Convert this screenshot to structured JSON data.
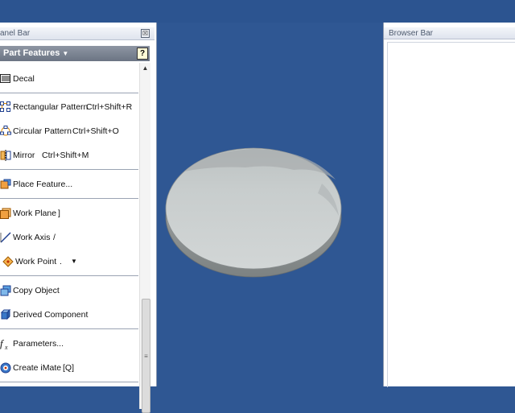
{
  "panel_bar": {
    "title": "anel Bar",
    "close_glyph": "☒",
    "section_label": "Part Features",
    "section_caret": "▼",
    "help_glyph": "?",
    "items": [
      {
        "label": "Decal",
        "shortcut": "",
        "icon": "decal-icon"
      },
      {
        "label": "Rectangular Pattern",
        "shortcut": "Ctrl+Shift+R",
        "icon": "rectangular-pattern-icon"
      },
      {
        "label": "Circular Pattern",
        "shortcut": "Ctrl+Shift+O",
        "icon": "circular-pattern-icon"
      },
      {
        "label": "Mirror",
        "shortcut": "Ctrl+Shift+M",
        "icon": "mirror-icon"
      },
      {
        "label": "Place Feature...",
        "shortcut": "",
        "icon": "place-feature-icon"
      },
      {
        "label": "Work Plane",
        "shortcut": "]",
        "icon": "work-plane-icon"
      },
      {
        "label": "Work Axis",
        "shortcut": "/",
        "icon": "work-axis-icon"
      },
      {
        "label": "Work Point",
        "shortcut": ".",
        "icon": "work-point-icon"
      },
      {
        "label": "Copy Object",
        "shortcut": "",
        "icon": "copy-object-icon"
      },
      {
        "label": "Derived Component",
        "shortcut": "",
        "icon": "derived-component-icon"
      },
      {
        "label": "Parameters...",
        "shortcut": "",
        "icon": "parameters-icon"
      },
      {
        "label": "Create iMate",
        "shortcut": "[Q]",
        "icon": "create-imate-icon"
      }
    ],
    "work_point_dropdown": "▼",
    "scroll_up_glyph": "▲",
    "scroll_grip_glyph": "≡"
  },
  "browser_bar": {
    "title": "Browser Bar"
  },
  "viewport": {
    "background": "#2f5793",
    "model": "disc"
  },
  "colors": {
    "background": "#2f5793",
    "panel": "#ffffff",
    "section_bar": "#7a8392"
  }
}
